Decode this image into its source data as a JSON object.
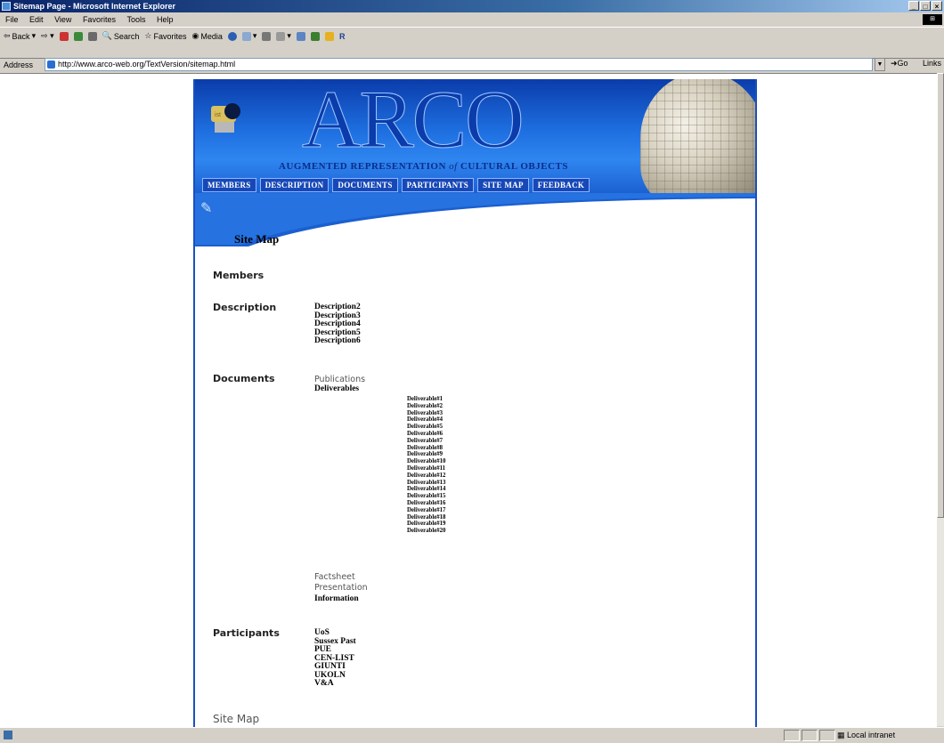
{
  "window": {
    "title": "Sitemap Page - Microsoft Internet Explorer"
  },
  "menu": [
    "File",
    "Edit",
    "View",
    "Favorites",
    "Tools",
    "Help"
  ],
  "toolbar": {
    "back": "Back",
    "search": "Search",
    "favorites": "Favorites",
    "media": "Media"
  },
  "address": {
    "label": "Address",
    "url": "http://www.arco-web.org/TextVersion/sitemap.html",
    "go": "Go",
    "links": "Links"
  },
  "status": {
    "zone": "Local intranet"
  },
  "page": {
    "logo_text": "ARCO",
    "subtitle_a": "AUGMENTED REPRESENTATION",
    "subtitle_of": "of",
    "subtitle_b": "CULTURAL OBJECTS",
    "nav": [
      "MEMBERS",
      "DESCRIPTION",
      "DOCUMENTS",
      "PARTICIPANTS",
      "SITE MAP",
      "FEEDBACK"
    ],
    "title": "Site Map",
    "members": "Members",
    "description": {
      "heading": "Description",
      "items": [
        "Description2",
        "Description3",
        "Description4",
        "Description5",
        "Description6"
      ]
    },
    "documents": {
      "heading": "Documents",
      "publications": "Publications",
      "deliverables": "Deliverables",
      "deliverable_items": [
        "Deliverable#1",
        "Deliverable#2",
        "Deliverable#3",
        "Deliverable#4",
        "Deliverable#5",
        "Deliverable#6",
        "Deliverable#7",
        "Deliverable#8",
        "Deliverable#9",
        "Deliverable#10",
        "Deliverable#11",
        "Deliverable#12",
        "Deliverable#13",
        "Deliverable#14",
        "Deliverable#15",
        "Deliverable#16",
        "Deliverable#17",
        "Deliverable#18",
        "Deliverable#19",
        "Deliverable#20"
      ],
      "factsheet": "Factsheet",
      "presentation": "Presentation",
      "information": "Information"
    },
    "participants": {
      "heading": "Participants",
      "items": [
        "UoS",
        "Sussex Past",
        "PUE",
        "CEN-LIST",
        "GIUNTI",
        "UKOLN",
        "V&A"
      ]
    },
    "bottom_heading": "Site Map"
  }
}
